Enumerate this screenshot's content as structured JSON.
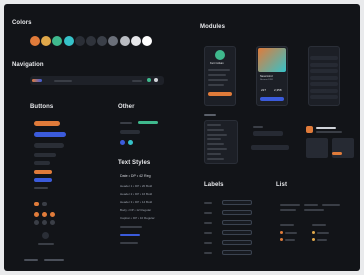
{
  "sections": {
    "colors": "Colors",
    "navigation": "Navigation",
    "buttons": "Buttons",
    "other": "Other",
    "text_styles": "Text Styles",
    "modules": "Modules",
    "labels": "Labels",
    "list": "List"
  },
  "palette": [
    "#e07b3a",
    "#e0a84a",
    "#3fb98d",
    "#36c2c9",
    "#2a2e36",
    "#2f333b",
    "#3a3f48",
    "#6b707a",
    "#b9bcc2",
    "#e6e7ea",
    "#ffffff"
  ],
  "accent_colors": {
    "orange": "#e07b3a",
    "teal": "#36c2c9",
    "blue": "#3b5bdb",
    "green": "#3fb98d",
    "background": "#121418",
    "surface": "#1c1f26"
  },
  "text_styles": {
    "sample": "Date • DP • 42 Reg",
    "line1": "Header 1 • DP • 20 Bold",
    "line2": "Header 2 • DP • 16 Bold",
    "line3": "Header 3 • DP • 14 Bold",
    "line4": "Body • DP • 12 Regular",
    "line5": "Caption • DP • 10 Regular"
  },
  "modules": {
    "profile_name": "Kurt Cobain",
    "stat_left": "227",
    "stat_right": "2,358",
    "card_title": "Nevermind",
    "card_subtitle": "Nirvana 1991"
  },
  "icons": [
    "search-icon",
    "settings-icon",
    "play-icon",
    "heart-icon",
    "user-icon"
  ]
}
